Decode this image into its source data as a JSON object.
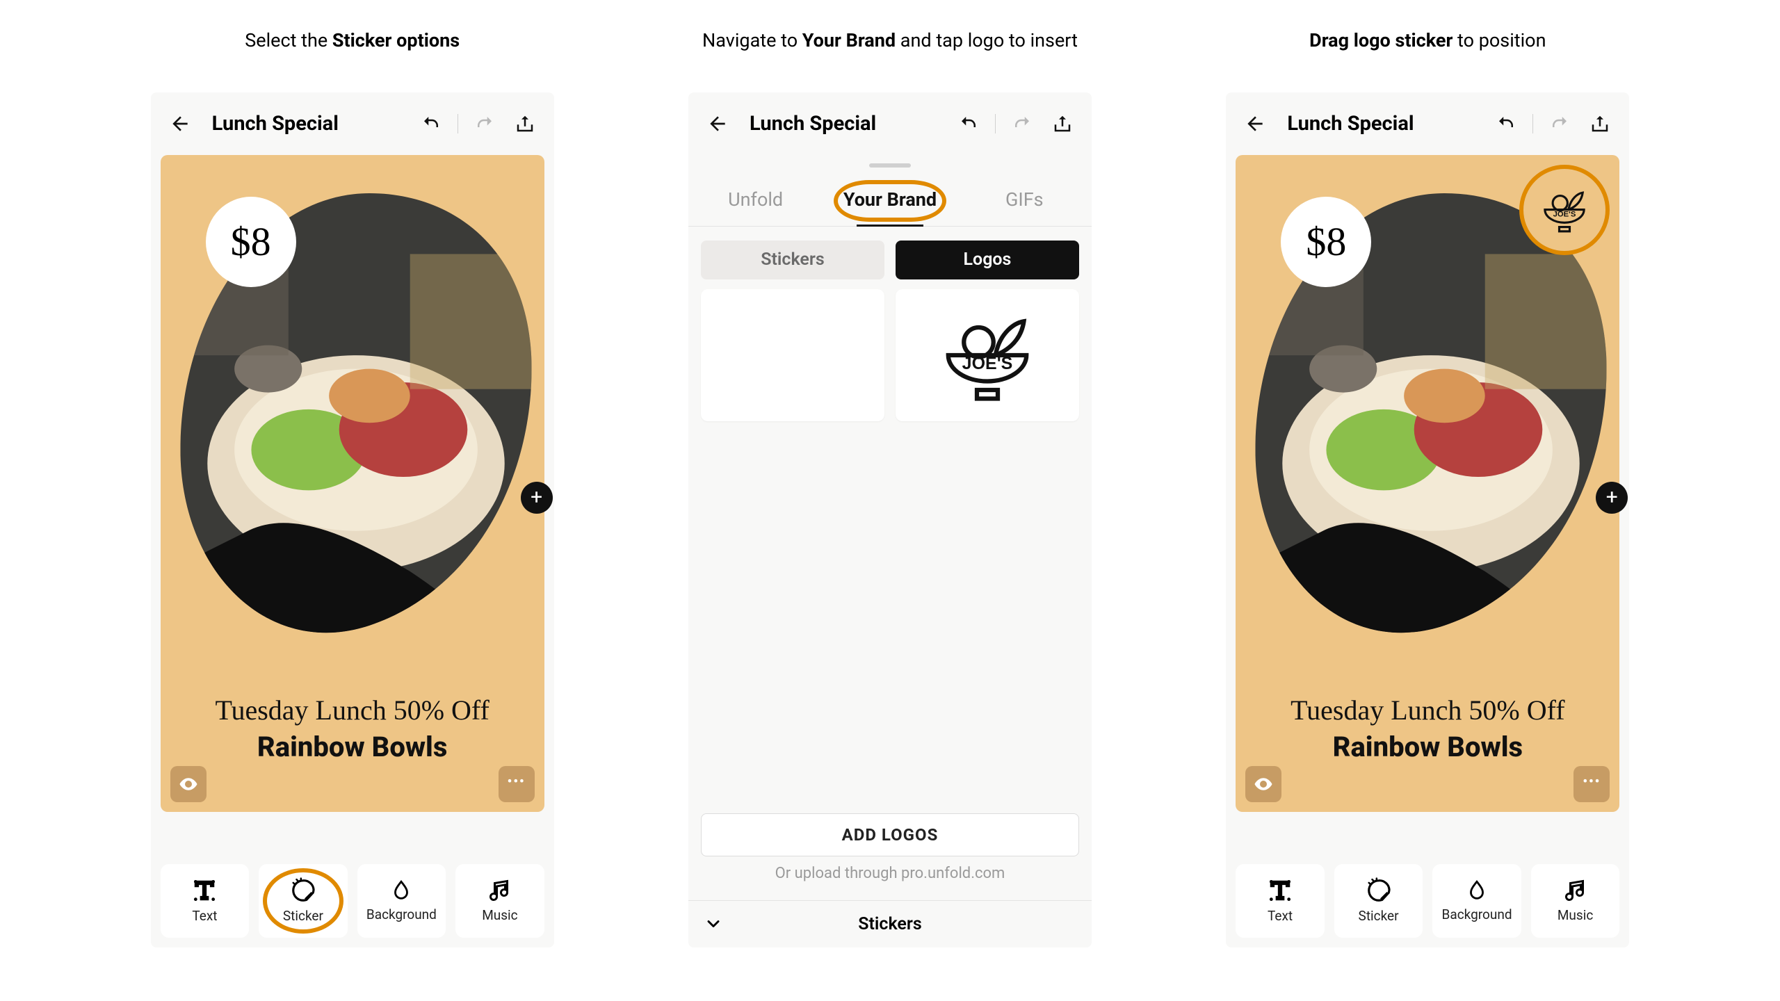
{
  "captions": {
    "c1_a": "Select the ",
    "c1_b": "Sticker options",
    "c2_a": "Navigate to ",
    "c2_b": "Your Brand",
    "c2_c": " and tap logo to insert",
    "c3_a": "Drag logo sticker",
    "c3_b": " to position"
  },
  "topbar": {
    "title": "Lunch Special"
  },
  "canvas": {
    "price": "$8",
    "headline": "Tuesday Lunch 50% Off",
    "subline": "Rainbow Bowls"
  },
  "toolbar": {
    "items": [
      {
        "label": "Text"
      },
      {
        "label": "Sticker"
      },
      {
        "label": "Background"
      },
      {
        "label": "Music"
      }
    ]
  },
  "panel": {
    "tabs": [
      {
        "label": "Unfold"
      },
      {
        "label": "Your Brand"
      },
      {
        "label": "GIFs"
      }
    ],
    "segments": {
      "stickers": "Stickers",
      "logos": "Logos"
    },
    "add_logos": "ADD LOGOS",
    "upload_note": "Or upload through pro.unfold.com",
    "footer": "Stickers",
    "joes": "JOE'S"
  }
}
